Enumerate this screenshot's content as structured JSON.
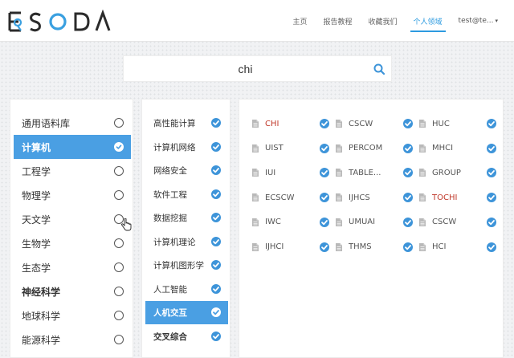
{
  "header": {
    "nav": [
      {
        "label": "主页",
        "active": false
      },
      {
        "label": "报告教程",
        "active": false
      },
      {
        "label": "收藏我们",
        "active": false
      },
      {
        "label": "个人领域",
        "active": true
      }
    ],
    "user": "test@te..."
  },
  "search": {
    "value": "chi",
    "icon": "search-icon"
  },
  "fields": [
    {
      "label": "通用语料库",
      "selected": false,
      "bold": false
    },
    {
      "label": "计算机",
      "selected": true,
      "bold": true
    },
    {
      "label": "工程学",
      "selected": false,
      "bold": false
    },
    {
      "label": "物理学",
      "selected": false,
      "bold": false
    },
    {
      "label": "天文学",
      "selected": false,
      "bold": false
    },
    {
      "label": "生物学",
      "selected": false,
      "bold": false
    },
    {
      "label": "生态学",
      "selected": false,
      "bold": false
    },
    {
      "label": "神经科学",
      "selected": false,
      "bold": true
    },
    {
      "label": "地球科学",
      "selected": false,
      "bold": false
    },
    {
      "label": "能源科学",
      "selected": false,
      "bold": false
    }
  ],
  "subfields": [
    {
      "label": "高性能计算",
      "active": false,
      "bold": false
    },
    {
      "label": "计算机网络",
      "active": false,
      "bold": false
    },
    {
      "label": "网络安全",
      "active": false,
      "bold": false
    },
    {
      "label": "软件工程",
      "active": false,
      "bold": false
    },
    {
      "label": "数据挖掘",
      "active": false,
      "bold": false
    },
    {
      "label": "计算机理论",
      "active": false,
      "bold": false
    },
    {
      "label": "计算机图形学",
      "active": false,
      "bold": false
    },
    {
      "label": "人工智能",
      "active": false,
      "bold": false
    },
    {
      "label": "人机交互",
      "active": true,
      "bold": true
    },
    {
      "label": "交叉综合",
      "active": false,
      "bold": true
    }
  ],
  "venues": [
    {
      "label": "CHI",
      "highlight": true
    },
    {
      "label": "CSCW",
      "highlight": false
    },
    {
      "label": "HUC",
      "highlight": false
    },
    {
      "label": "UIST",
      "highlight": false
    },
    {
      "label": "PERCOM",
      "highlight": false
    },
    {
      "label": "MHCI",
      "highlight": false
    },
    {
      "label": "IUI",
      "highlight": false
    },
    {
      "label": "TABLE...",
      "highlight": false
    },
    {
      "label": "GROUP",
      "highlight": false
    },
    {
      "label": "ECSCW",
      "highlight": false
    },
    {
      "label": "IJHCS",
      "highlight": false
    },
    {
      "label": "TOCHI",
      "highlight": true
    },
    {
      "label": "IWC",
      "highlight": false
    },
    {
      "label": "UMUAI",
      "highlight": false
    },
    {
      "label": "CSCW",
      "highlight": false
    },
    {
      "label": "IJHCI",
      "highlight": false
    },
    {
      "label": "THMS",
      "highlight": false
    },
    {
      "label": "HCI",
      "highlight": false
    }
  ],
  "colors": {
    "accent": "#4a9fe3",
    "check": "#3d94d9",
    "highlight": "#c0392b"
  }
}
